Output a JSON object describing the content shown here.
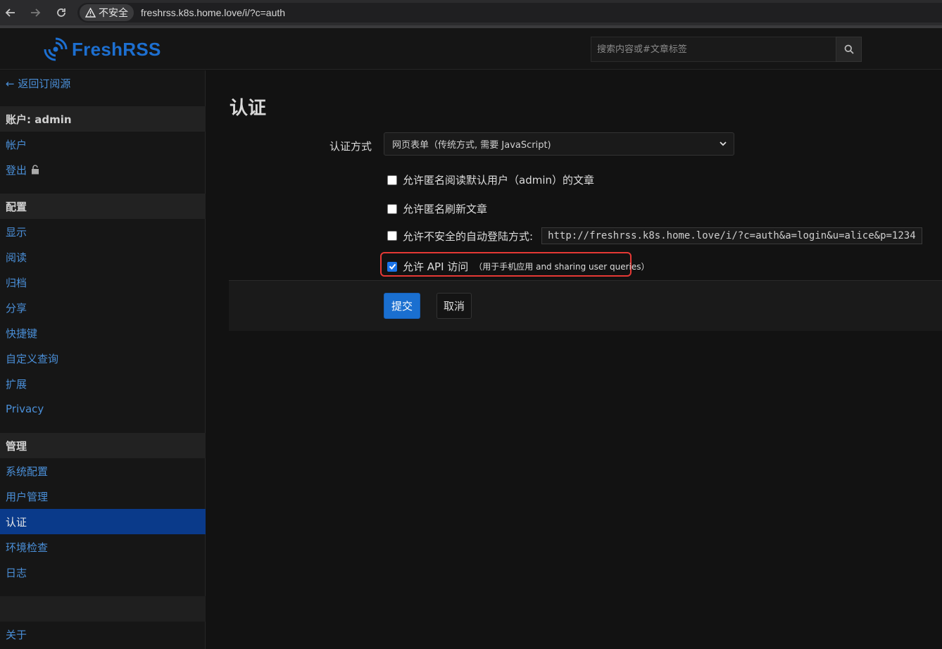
{
  "browser": {
    "insecure_label": "不安全",
    "url": "freshrss.k8s.home.love/i/?c=auth"
  },
  "app": {
    "logo_text": "FreshRSS",
    "search_placeholder": "搜索内容或#文章标签"
  },
  "sidebar": {
    "back": "← 返回订阅源",
    "account_head": "账户: admin",
    "account_items": [
      "帐户",
      "登出"
    ],
    "config_head": "配置",
    "config_items": [
      "显示",
      "阅读",
      "归档",
      "分享",
      "快捷键",
      "自定义查询",
      "扩展",
      "Privacy"
    ],
    "admin_head": "管理",
    "admin_items": [
      "系统配置",
      "用户管理",
      "认证",
      "环境检查",
      "日志"
    ],
    "active_item": "认证",
    "about": "关于"
  },
  "main": {
    "title": "认证",
    "auth_label": "认证方式",
    "auth_select_value": "网页表单（传统方式, 需要 JavaScript)",
    "options": {
      "anon_read": "允许匿名阅读默认用户（admin）的文章",
      "anon_refresh": "允许匿名刷新文章",
      "unsafe_login": "允许不安全的自动登陆方式:",
      "unsafe_login_url": "http://freshrss.k8s.home.love/i/?c=auth&a=login&u=alice&p=1234",
      "api_access": "允许 API 访问",
      "api_access_note": "（用于手机应用 and sharing user queries）"
    },
    "checked": {
      "anon_read": false,
      "anon_refresh": false,
      "unsafe_login": false,
      "api_access": true
    },
    "submit": "提交",
    "cancel": "取消"
  },
  "colors": {
    "accent": "#1a6fd0",
    "link": "#4a8fd8",
    "highlight_border": "#e53935",
    "active_nav": "#0a3a8a"
  }
}
